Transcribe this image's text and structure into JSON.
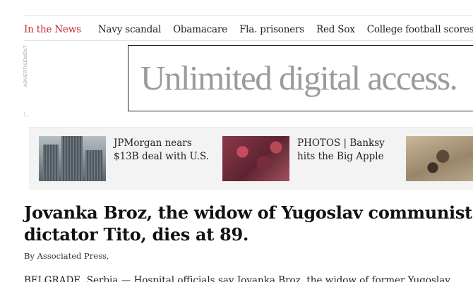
{
  "in_the_news": {
    "label": "In the News",
    "links": [
      "Navy scandal",
      "Obamacare",
      "Fla. prisoners",
      "Red Sox",
      "College football scores"
    ]
  },
  "advertisement": {
    "label": "ADVERTISEMENT",
    "text": "Unlimited digital access."
  },
  "promos": [
    {
      "caption": "JPMorgan nears $13B deal with U.S.",
      "image_icon": "bank-towers-photo"
    },
    {
      "caption": "PHOTOS | Banksy hits the Big Apple",
      "image_icon": "street-art-photo"
    },
    {
      "caption": "",
      "image_icon": "sculpture-photo"
    }
  ],
  "article": {
    "headline": "Jovanka Broz, the widow of Yugoslav communist dictator Tito, dies at 89.",
    "byline_prefix": "By",
    "byline_author": "Associated Press,",
    "body_start": "BELGRADE, Serbia — Hospital officials say Jovanka Broz, the widow of former Yugoslav"
  },
  "colors": {
    "accent": "#c9252d",
    "promo_background": "#f3f3f3"
  }
}
